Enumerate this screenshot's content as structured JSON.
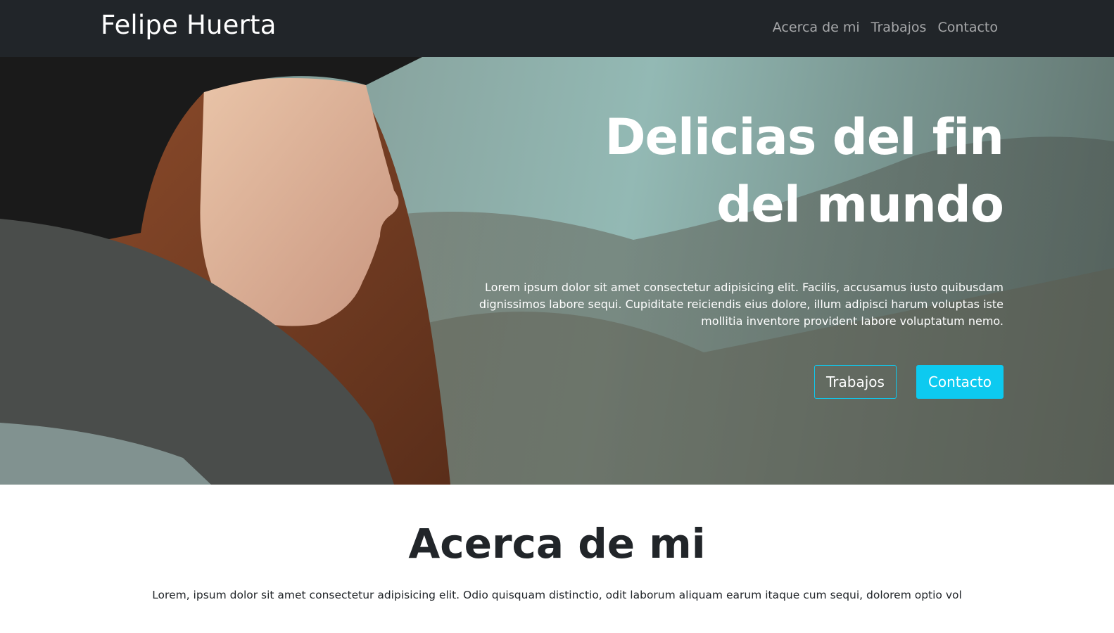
{
  "navbar": {
    "brand": "Felipe Huerta",
    "links": [
      "Acerca de mi",
      "Trabajos",
      "Contacto"
    ]
  },
  "hero": {
    "title_line1": "Delicias del fin",
    "title_line2": "del mundo",
    "text": "Lorem ipsum dolor sit amet consectetur adipisicing elit. Facilis, accusamus iusto quibusdam dignissimos labore sequi. Cupiditate reiciendis eius dolore, illum adipisci harum voluptas iste mollitia inventore provident labore voluptatum nemo.",
    "buttons": {
      "primary": "Trabajos",
      "secondary": "Contacto"
    },
    "background_image": "woman-portrait-photo"
  },
  "about": {
    "title": "Acerca de mi",
    "text": "Lorem, ipsum dolor sit amet consectetur adipisicing elit. Odio quisquam distinctio, odit laborum aliquam earum itaque cum sequi, dolorem optio vol"
  },
  "colors": {
    "navbar_bg": "#212529",
    "accent": "#0dcaf0",
    "text_dark": "#212529"
  }
}
